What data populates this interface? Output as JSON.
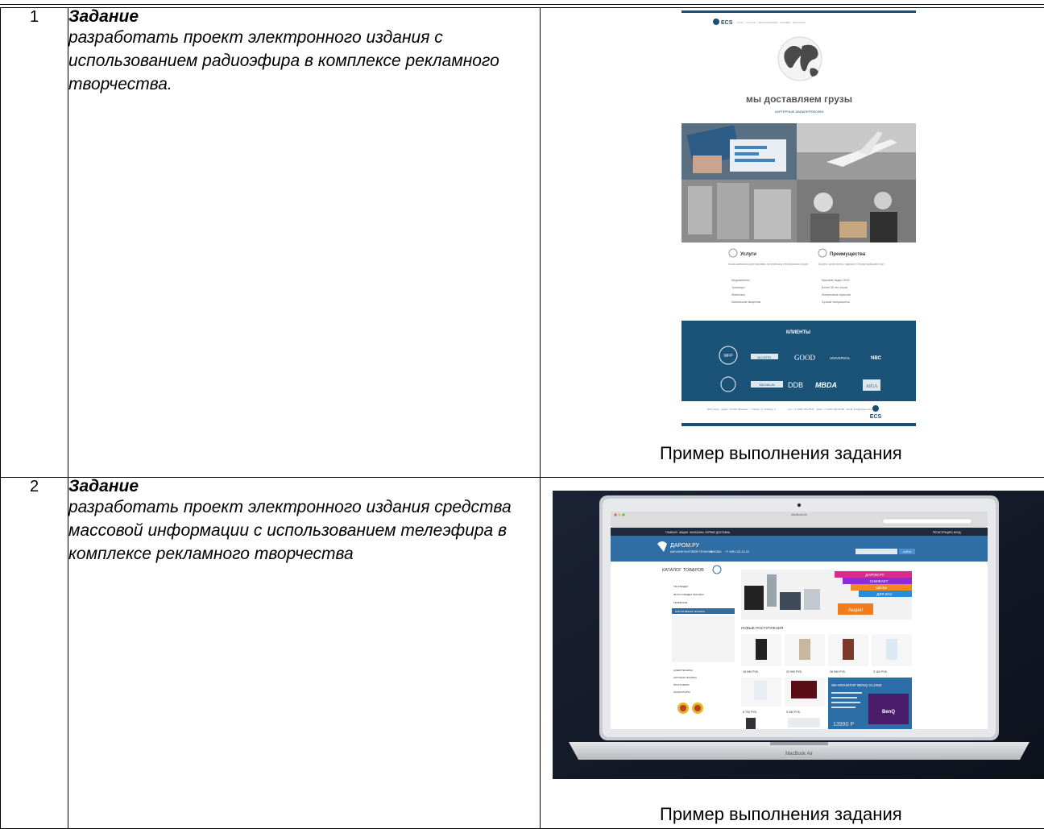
{
  "rows": [
    {
      "number": "1",
      "task_heading": "Задание",
      "task_text": "разработать проект электронного издания с использованием радиоэфира в комплексе рекламного творчества.",
      "caption": "Пример выполнения задания",
      "example": {
        "logo": "ECS",
        "nav": "О НАС · УСЛУГИ · ОБОРУДОВАНИЕ · ОТЗЫВЫ · КОНТАКТЫ",
        "headline": "мы доставляем грузы",
        "subheadline": "ЧАРТЕРНЫЕ АВИАПЕРЕВОЗКИ",
        "services_title": "Услуги",
        "services_intro": "Наша компания ориентирована на перевозку негабаритных грузов",
        "services_items": [
          "Медикаменты",
          "Транспорт",
          "Животные",
          "Химические вещества"
        ],
        "advantages_title": "Преимущества",
        "advantages_intro": "Быстро, качественно, надежно! Почему выбирают нас?",
        "advantages_items": [
          "Мировой лидер GDO",
          "Более 30 лет опыта",
          "Финансовые гарантии",
          "Лучшие специалисты"
        ],
        "clients_title": "КЛИЕНТЫ",
        "client_logos": [
          "WFP",
          "ALCATEL",
          "GOOD",
          "UNIVERSAL",
          "NBC",
          "MICHELIN",
          "DDB",
          "MBDA",
          "AIGA"
        ],
        "footer_left": "ECS group · адрес: 75 008, Франция · г. Париж, ул. Лаборд, 1",
        "footer_mid": "тел.: +7 (495) 123-45-67 · факс: +7 (495) 123-45-68 · Email: info@cargo-ecs.com",
        "footer_logo": "ECS"
      }
    },
    {
      "number": "2",
      "task_heading": "Задание",
      "task_text": "разработать проект  электронного издания средства массовой информации с использованием телеэфира в комплексе рекламного творчества",
      "caption": "Пример выполнения задания",
      "example": {
        "device_label": "MacBook Air",
        "window_title": "MacBook Air",
        "top_menu": [
          "ГЛАВНАЯ",
          "АКЦИИ",
          "МАГАЗИНЫ",
          "СЕРВИС",
          "ДОСТАВКА"
        ],
        "register_link": "РЕГИСТРАЦИЯ | ВХОД",
        "brand": "ДАРОМ.РУ",
        "brand_tagline": "МАГАЗИН БЫТОВОЙ ТЕХНИКИ",
        "phone": "+7 495 123-12-12",
        "city": "МОСКВА",
        "search_button": "НАЙТИ",
        "catalog_title": "КАТАЛОГ ТОВАРОВ",
        "catalog_items": [
          "ТВ И ВИДЕО",
          "ФОТО И ВИДЕО ТЕХНИКА",
          "ТЕЛЕФОНЫ",
          "ПОРТАТИВНАЯ ТЕХНИКА",
          "АУДИОТЕХНИКА",
          "КРУПНАЯ ТЕХНИКА",
          "ПРОГРАММЫ",
          "АКСЕССУАРЫ"
        ],
        "promo_lines": [
          "ДАРОМ.РУ",
          "СНИЖАЕТ",
          "ЦЕНЫ",
          "ДЛЯ ВАС"
        ],
        "promo_badge": "Акция!",
        "new_arrivals": "НОВЫЕ ПОСТУПЛЕНИЯ",
        "prices": [
          "15 990 РУБ.",
          "20 990 РУБ.",
          "28 990 РУБ.",
          "3 160 РУБ.",
          "8 790 РУБ.",
          "9 350 РУБ."
        ],
        "monitor_promo": "ЖК-МОНИТОР BENQ GL2460",
        "monitor_price": "13990 Р",
        "monitor_brand": "BenQ"
      }
    }
  ]
}
